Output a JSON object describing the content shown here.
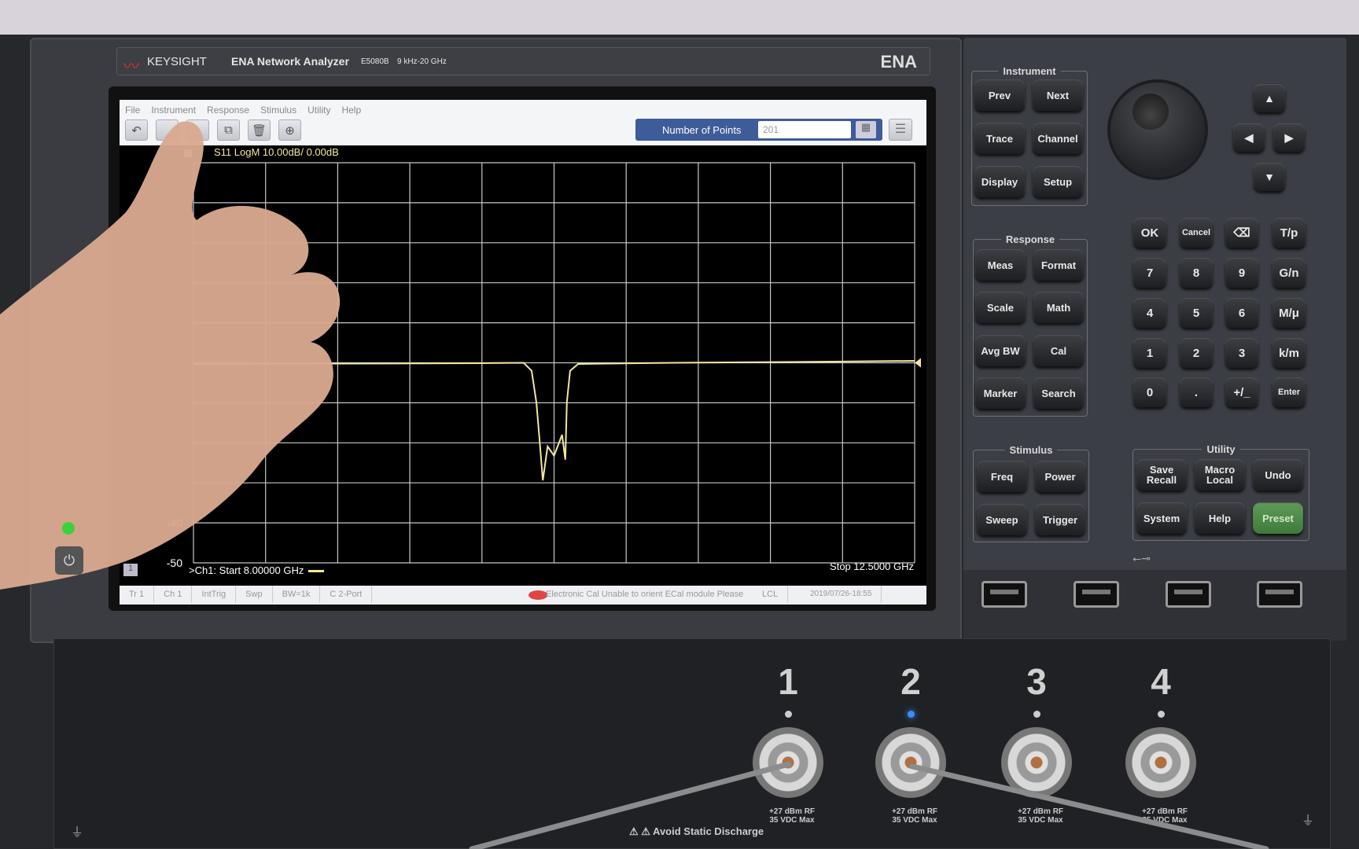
{
  "header": {
    "brand": "KEYSIGHT",
    "product": "ENA Network Analyzer",
    "model": "E5080B",
    "range": "9 kHz-20 GHz",
    "badge": "ENA"
  },
  "menu": [
    "File",
    "Instrument",
    "Response",
    "Stimulus",
    "Utility",
    "Help"
  ],
  "toolbar": {
    "icons": [
      "undo-icon",
      "blank",
      "blank",
      "screen-capture-icon",
      "trash-icon",
      "zoom-icon"
    ],
    "points_label": "Number of Points",
    "points_value": "201"
  },
  "trace_header": "S11 LogM 10.00dB/ 0.00dB",
  "footer": {
    "start": ">Ch1: Start  8.00000 GHz",
    "stop": "Stop  12.5000 GHz",
    "channel_badge": "1"
  },
  "status": {
    "items": [
      "Tr 1",
      "Ch 1",
      "IntTrig",
      "Swp",
      "BW=1k",
      "C  2-Port"
    ],
    "message": "Electronic Cal   Unable to orient ECal module  Please",
    "lcl": "LCL",
    "datetime": "2019/07/26-18:55"
  },
  "chart_data": {
    "type": "line",
    "title": "S11 LogM 10.00dB/ 0.00dB",
    "xlim": [
      8.0,
      12.5
    ],
    "ylim": [
      -50,
      50
    ],
    "x_unit": "GHz",
    "y_unit": "dB",
    "ytick_labels_visible": [
      "-40",
      "-50"
    ],
    "grid": true,
    "divisions": {
      "x": 10,
      "y": 10
    },
    "trace_color": "#f2e6a0",
    "series": [
      {
        "x": [
          8.0,
          9.0,
          9.8,
          10.06,
          10.11,
          10.14,
          10.16,
          10.18,
          10.21,
          10.25,
          10.3,
          10.32,
          10.33,
          10.35,
          10.4,
          11.0,
          12.0,
          12.5
        ],
        "y": [
          -0.3,
          -0.2,
          -0.1,
          0,
          -2,
          -10,
          -19.6,
          -29.4,
          -20.9,
          -23.2,
          -18,
          -24.2,
          -9.8,
          -2,
          -0.3,
          0,
          0.3,
          0.5
        ]
      }
    ]
  },
  "panel": {
    "instrument": {
      "title": "Instrument",
      "buttons": [
        "Prev",
        "Next",
        "Trace",
        "Channel",
        "Display",
        "Setup"
      ]
    },
    "response": {
      "title": "Response",
      "buttons": [
        "Meas",
        "Format",
        "Scale",
        "Math",
        "Avg BW",
        "Cal",
        "Marker",
        "Search"
      ]
    },
    "stimulus": {
      "title": "Stimulus",
      "buttons": [
        "Freq",
        "Power",
        "Sweep",
        "Trigger"
      ]
    },
    "utility": {
      "title": "Utility",
      "buttons": [
        "Save\nRecall",
        "Macro\nLocal",
        "Undo",
        "System",
        "Help",
        "Preset"
      ]
    },
    "keypad": [
      "OK",
      "Cancel",
      "⌫",
      "T/p",
      "7",
      "8",
      "9",
      "G/n",
      "4",
      "5",
      "6",
      "M/μ",
      "1",
      "2",
      "3",
      "k/m",
      "0",
      ".",
      "+/_",
      "Enter"
    ],
    "arrows": [
      "▲",
      "◀",
      "▶",
      "▼"
    ],
    "preset_color": "#4f8a4a"
  },
  "ports": {
    "numbers": [
      "1",
      "2",
      "3",
      "4"
    ],
    "rating": "+27 dBm RF\n35 VDC Max",
    "active_port": "2",
    "led_active_color": "#3b8cff",
    "warning": "⚠ ⚠ Avoid Static Discharge"
  }
}
